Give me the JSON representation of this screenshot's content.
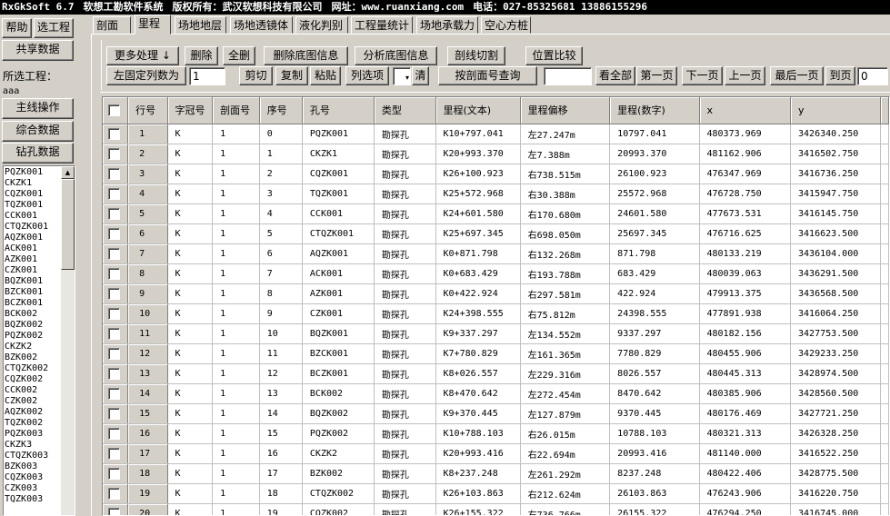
{
  "title": {
    "app": "RxGkSoft 6.7",
    "name": "软想工勘软件系统",
    "copyright": "版权所有：武汉软想科技有限公司",
    "website": "网址：www.ruanxiang.com",
    "phone": "电话：027-85325681 13886155296"
  },
  "left": {
    "help": "帮助",
    "select_project": "选工程",
    "shared_data": "共享数据",
    "selected_project_label": "所选工程：",
    "project_name": "aaa",
    "main_ops": "主线操作",
    "combined_data": "综合数据",
    "drill_data": "钻孔数据",
    "holes": [
      "PQZK001",
      "CKZK1",
      "CQZK001",
      "TQZK001",
      "CCK001",
      "CTQZK001",
      "AQZK001",
      "ACK001",
      "AZK001",
      "CZK001",
      "BQZK001",
      "BZCK001",
      "BCZK001",
      "BCK002",
      "BQZK002",
      "PQZK002",
      "CKZK2",
      "BZK002",
      "CTQZK002",
      "CQZK002",
      "CCK002",
      "CZK002",
      "AQZK002",
      "TQZK002",
      "PQZK003",
      "CKZK3",
      "CTQZK003",
      "BZK003",
      "CQZK003",
      "CZK003",
      "TQZK003"
    ]
  },
  "tabs": [
    "剖面",
    "里程",
    "场地地层",
    "场地透镜体",
    "液化判别",
    "工程量统计",
    "场地承载力",
    "空心方桩"
  ],
  "active_tab": 1,
  "toolbar": {
    "more": "更多处理",
    "more_icon": "arrow-down",
    "delete": "删除",
    "delete_all": "全删",
    "delete_base_info": "删除底图信息",
    "analyze_base_info": "分析底图信息",
    "section_cut": "剖线切割",
    "position_compare": "位置比较",
    "fixed_cols_label": "左固定列数为",
    "fixed_cols_value": "1",
    "cut": "剪切",
    "copy": "复制",
    "paste": "粘贴",
    "column_select": "列选项",
    "clear": "清",
    "query_by_section": "按剖面号查询",
    "query_value": "",
    "show_all": "看全部",
    "first_page": "第一页",
    "next_page": "下一页",
    "prev_page": "上一页",
    "last_page": "最后一页",
    "goto_page": "到页",
    "page_value": "0"
  },
  "table": {
    "columns": [
      "行号",
      "字冠号",
      "剖面号",
      "序号",
      "孔号",
      "类型",
      "里程(文本)",
      "里程偏移",
      "里程(数字)",
      "x",
      "y"
    ],
    "rows": [
      [
        "1",
        "K",
        "1",
        "0",
        "PQZK001",
        "勘探孔",
        "K10+797.041",
        "左27.247m",
        "10797.041",
        "480373.969",
        "3426340.250"
      ],
      [
        "2",
        "K",
        "1",
        "1",
        "CKZK1",
        "勘探孔",
        "K20+993.370",
        "左7.388m",
        "20993.370",
        "481162.906",
        "3416502.750"
      ],
      [
        "3",
        "K",
        "1",
        "2",
        "CQZK001",
        "勘探孔",
        "K26+100.923",
        "右738.515m",
        "26100.923",
        "476347.969",
        "3416736.250"
      ],
      [
        "4",
        "K",
        "1",
        "3",
        "TQZK001",
        "勘探孔",
        "K25+572.968",
        "右30.388m",
        "25572.968",
        "476728.750",
        "3415947.750"
      ],
      [
        "5",
        "K",
        "1",
        "4",
        "CCK001",
        "勘探孔",
        "K24+601.580",
        "右170.680m",
        "24601.580",
        "477673.531",
        "3416145.750"
      ],
      [
        "6",
        "K",
        "1",
        "5",
        "CTQZK001",
        "勘探孔",
        "K25+697.345",
        "右698.050m",
        "25697.345",
        "476716.625",
        "3416623.500"
      ],
      [
        "7",
        "K",
        "1",
        "6",
        "AQZK001",
        "勘探孔",
        "K0+871.798",
        "右132.268m",
        "871.798",
        "480133.219",
        "3436104.000"
      ],
      [
        "8",
        "K",
        "1",
        "7",
        "ACK001",
        "勘探孔",
        "K0+683.429",
        "右193.788m",
        "683.429",
        "480039.063",
        "3436291.500"
      ],
      [
        "9",
        "K",
        "1",
        "8",
        "AZK001",
        "勘探孔",
        "K0+422.924",
        "右297.581m",
        "422.924",
        "479913.375",
        "3436568.500"
      ],
      [
        "10",
        "K",
        "1",
        "9",
        "CZK001",
        "勘探孔",
        "K24+398.555",
        "右75.812m",
        "24398.555",
        "477891.938",
        "3416064.250"
      ],
      [
        "11",
        "K",
        "1",
        "10",
        "BQZK001",
        "勘探孔",
        "K9+337.297",
        "左134.552m",
        "9337.297",
        "480182.156",
        "3427753.500"
      ],
      [
        "12",
        "K",
        "1",
        "11",
        "BZCK001",
        "勘探孔",
        "K7+780.829",
        "左161.365m",
        "7780.829",
        "480455.906",
        "3429233.250"
      ],
      [
        "13",
        "K",
        "1",
        "12",
        "BCZK001",
        "勘探孔",
        "K8+026.557",
        "左229.316m",
        "8026.557",
        "480445.313",
        "3428974.500"
      ],
      [
        "14",
        "K",
        "1",
        "13",
        "BCK002",
        "勘探孔",
        "K8+470.642",
        "左272.454m",
        "8470.642",
        "480385.906",
        "3428560.500"
      ],
      [
        "15",
        "K",
        "1",
        "14",
        "BQZK002",
        "勘探孔",
        "K9+370.445",
        "左127.879m",
        "9370.445",
        "480176.469",
        "3427721.250"
      ],
      [
        "16",
        "K",
        "1",
        "15",
        "PQZK002",
        "勘探孔",
        "K10+788.103",
        "右26.015m",
        "10788.103",
        "480321.313",
        "3426328.250"
      ],
      [
        "17",
        "K",
        "1",
        "16",
        "CKZK2",
        "勘探孔",
        "K20+993.416",
        "右22.694m",
        "20993.416",
        "481140.000",
        "3416522.250"
      ],
      [
        "18",
        "K",
        "1",
        "17",
        "BZK002",
        "勘探孔",
        "K8+237.248",
        "左261.292m",
        "8237.248",
        "480422.406",
        "3428775.500"
      ],
      [
        "19",
        "K",
        "1",
        "18",
        "CTQZK002",
        "勘探孔",
        "K26+103.863",
        "右212.624m",
        "26103.863",
        "476243.906",
        "3416220.750"
      ],
      [
        "20",
        "K",
        "1",
        "19",
        "CQZK002",
        "勘探孔",
        "K26+155.322",
        "右736.766m",
        "26155.322",
        "476294.250",
        "3416745.000"
      ]
    ]
  }
}
